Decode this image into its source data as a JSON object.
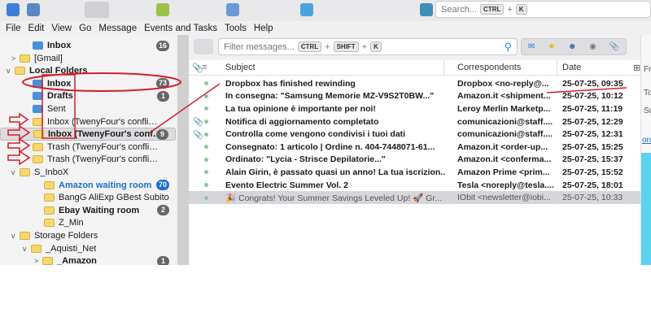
{
  "toolbar": {
    "search_placeholder": "Search...",
    "kbd_ctrl": "CTRL",
    "plus": "+",
    "kbd_k": "K"
  },
  "menu": [
    "File",
    "Edit",
    "View",
    "Go",
    "Message",
    "Events and Tasks",
    "Tools",
    "Help"
  ],
  "folders": [
    {
      "label": "Inbox",
      "count": "16",
      "bold": true,
      "icon": "inbox"
    },
    {
      "label": "[Gmail]",
      "icon": "folder"
    },
    {
      "label": "Local Folders",
      "bold": true,
      "icon": "folder"
    },
    {
      "label": "Inbox",
      "count": "73",
      "bold": true,
      "icon": "inbox"
    },
    {
      "label": "Drafts",
      "count": "1",
      "bold": true,
      "icon": "drafts"
    },
    {
      "label": "Sent",
      "icon": "sent"
    },
    {
      "label": "Inbox (TwenyFour's conflicted ...",
      "icon": "folder"
    },
    {
      "label": "Inbox (TwenyFour's confl...",
      "count": "9",
      "bold": true,
      "icon": "folder"
    },
    {
      "label": "Trash (TwenyFour's conflicted c...",
      "icon": "folder"
    },
    {
      "label": "Trash (TwenyFour's conflicted c...",
      "icon": "folder"
    },
    {
      "label": "S_InboX",
      "icon": "folder"
    },
    {
      "label": "Amazon waiting room",
      "count": "70",
      "bold": true,
      "icon": "folder"
    },
    {
      "label": "BangG AliExp GBest Subito",
      "icon": "folder"
    },
    {
      "label": "Ebay Waiting room",
      "count": "2",
      "bold": true,
      "icon": "folder"
    },
    {
      "label": "Z_Min",
      "icon": "folder"
    },
    {
      "label": "Storage Folders",
      "icon": "folder"
    },
    {
      "label": "_Aquisti_Net",
      "icon": "folder"
    },
    {
      "label": "_Amazon",
      "count": "1",
      "bold": true,
      "icon": "folder"
    }
  ],
  "filter": {
    "placeholder": "Filter messages...",
    "kbd_ctrl": "CTRL",
    "kbd_shift": "SHIFT",
    "kbd_k": "K",
    "plus": "+"
  },
  "columns": {
    "subject": "Subject",
    "correspondents": "Correspondents",
    "date": "Date"
  },
  "messages": [
    {
      "subject": "Dropbox has finished rewinding",
      "from": "Dropbox <no-reply@...",
      "date": "25-07-25, 09:35",
      "att": false
    },
    {
      "subject": "In consegna: \"Samsung Memorie MZ-V9S2T0BW...\"",
      "from": "Amazon.it <shipment...",
      "date": "25-07-25, 10:12",
      "att": false
    },
    {
      "subject": "La tua opinione è importante per noi!",
      "from": "Leroy Merlin Marketp...",
      "date": "25-07-25, 11:19",
      "att": false
    },
    {
      "subject": "Notifica di aggiornamento completato",
      "from": "comunicazioni@staff....",
      "date": "25-07-25, 12:29",
      "att": true
    },
    {
      "subject": "Controlla come vengono condivisi i tuoi dati",
      "from": "comunicazioni@staff....",
      "date": "25-07-25, 12:31",
      "att": true
    },
    {
      "subject": "Consegnato: 1 articolo | Ordine n. 404-7448071-61...",
      "from": "Amazon.it <order-up...",
      "date": "25-07-25, 15:25",
      "att": false
    },
    {
      "subject": "Ordinato: \"Lycia - Strisce Depilatorie...\"",
      "from": "Amazon.it <conferma...",
      "date": "25-07-25, 15:37",
      "att": false
    },
    {
      "subject": "Alain Girin, è passato quasi un anno! La tua iscrizion...",
      "from": "Amazon Prime <prim...",
      "date": "25-07-25, 15:52",
      "att": false
    },
    {
      "subject": "Evento Electric Summer Vol. 2",
      "from": "Tesla <noreply@tesla....",
      "date": "25-07-25, 18:01",
      "att": false
    },
    {
      "subject": "🎉 Congrats! Your Summer Savings Leveled Up! 🚀 Gr...",
      "from": "IObit <newsletter@iobi...",
      "date": "25-07-25, 10:33",
      "att": false,
      "selected": true
    }
  ],
  "preview": {
    "from": "Fr",
    "to": "To",
    "subject": "Su",
    "link": "on"
  },
  "colors": {
    "annotation": "#d0202a",
    "accent": "#1a6fd1"
  }
}
